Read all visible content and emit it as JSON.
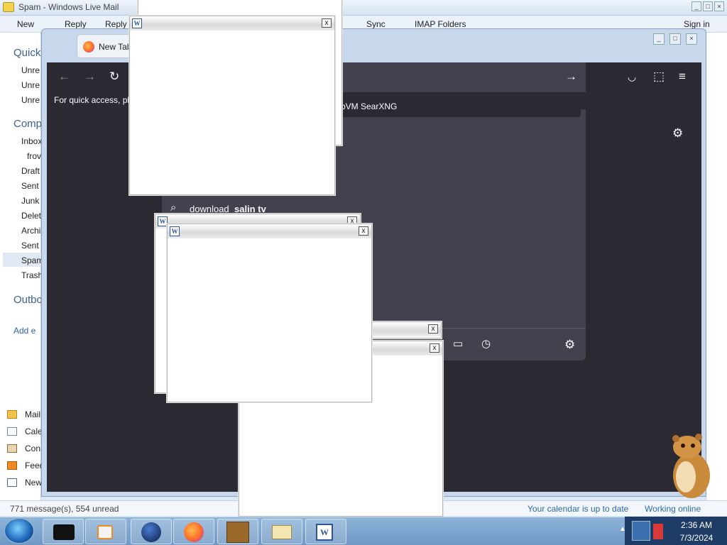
{
  "mail": {
    "window_title": "Spam - Windows Live Mail",
    "sign_in": "Sign in",
    "toolbar": {
      "new": "New",
      "reply": "Reply",
      "reply_all": "Reply",
      "sync": "Sync",
      "imap_folders": "IMAP Folders"
    },
    "sidebar": {
      "quick_header": "Quick",
      "quick_items": [
        "Unre",
        "Unre",
        "Unre"
      ],
      "comp_header": "Comp",
      "folders": [
        "Inbox",
        "frov",
        "Draft",
        "Sent",
        "Junk",
        "Delet",
        "Archi",
        "Sent",
        "Spam",
        "Trash"
      ],
      "outbox": "Outbo",
      "add_email": "Add e",
      "nav": [
        "Mail",
        "Cale",
        "Con",
        "Feed",
        "New"
      ]
    },
    "status_left": "771 message(s), 554 unread",
    "status_calendar": "Your calendar is up to date",
    "status_online": "Working online"
  },
  "firefox": {
    "tab_title": "New Tab",
    "bookmark_hint": "For quick access, pla",
    "search_engine": "bVM SearXNG",
    "suggestion_prefix": "download ",
    "suggestion_bold": "salin tv"
  },
  "taskbar": {
    "time": "2:36 AM",
    "date": "7/3/2024",
    "items": [
      "terminal-icon",
      "media-player-icon",
      "globe-icon",
      "firefox-icon",
      "box-game-icon",
      "mail-icon",
      "word-icon"
    ]
  },
  "word_popups": {
    "icon_letter": "W",
    "close": "x"
  }
}
